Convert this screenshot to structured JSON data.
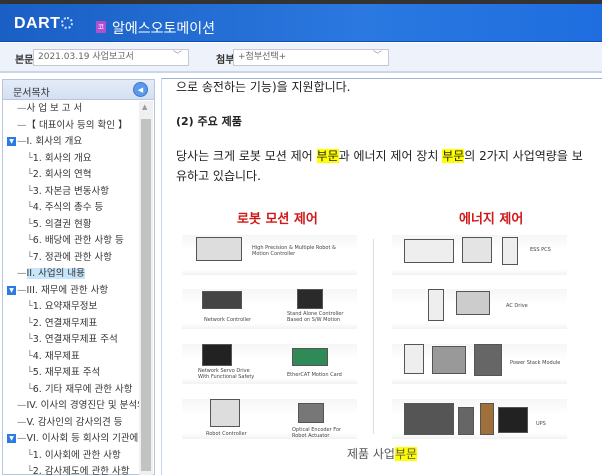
{
  "header": {
    "logo": "DART",
    "corp_badge": "코",
    "company": "알에스오토메이션"
  },
  "toolbar": {
    "main_label": "본문",
    "main_value": "2021.03.19  사업보고서",
    "attach_label": "첨부",
    "attach_value": "+첨부선택+"
  },
  "sidebar": {
    "title": "문서목차",
    "items": [
      {
        "label": "사 업 보 고 서",
        "level": 0
      },
      {
        "label": "【 대표이사 등의 확인 】",
        "level": 0
      },
      {
        "label": "I. 회사의 개요",
        "level": 0,
        "expanded": true
      },
      {
        "label": "1. 회사의 개요",
        "level": 1
      },
      {
        "label": "2. 회사의 연혁",
        "level": 1
      },
      {
        "label": "3. 자본금 변동사항",
        "level": 1
      },
      {
        "label": "4. 주식의 총수 등",
        "level": 1
      },
      {
        "label": "5. 의결권 현황",
        "level": 1
      },
      {
        "label": "6. 배당에 관한 사항 등",
        "level": 1
      },
      {
        "label": "7. 정관에 관한 사항",
        "level": 1
      },
      {
        "label": "II. 사업의 내용",
        "level": 0,
        "selected": true
      },
      {
        "label": "III. 재무에 관한 사항",
        "level": 0,
        "expanded": true
      },
      {
        "label": "1. 요약재무정보",
        "level": 1
      },
      {
        "label": "2. 연결재무제표",
        "level": 1
      },
      {
        "label": "3. 연결재무제표 주석",
        "level": 1
      },
      {
        "label": "4. 재무제표",
        "level": 1
      },
      {
        "label": "5. 재무제표 주석",
        "level": 1
      },
      {
        "label": "6. 기타 재무에 관한 사항",
        "level": 1
      },
      {
        "label": "IV. 이사의 경영진단 및 분석의견",
        "level": 0
      },
      {
        "label": "V. 감사인의 감사의견 등",
        "level": 0
      },
      {
        "label": "VI. 이사회 등 회사의 기관에 관한 사항",
        "level": 0,
        "expanded": true
      },
      {
        "label": "1. 이사회에 관한 사항",
        "level": 1
      },
      {
        "label": "2. 감사제도에 관한 사항",
        "level": 1
      }
    ]
  },
  "content": {
    "line_top": "으로 송전하는 기능)을 지원합니다.",
    "section_title": "(2) 주요 제품",
    "para1_a": "당사는 크게 로봇 모션 제어 ",
    "para1_hl1": "부문",
    "para1_b": "과 에너지 제어 장치 ",
    "para1_hl2": "부문",
    "para1_c": "의 2가지 사업역량을 보",
    "para2": "유하고 있습니다.",
    "figure": {
      "left_title": "로봇 모션 제어",
      "right_title": "에너지 제어",
      "left_labels": [
        "High Precision & Multiple Robot & Motion Controller",
        "Network Controller",
        "Stand Alone Controller Based on S/W Motion",
        "Network Servo Drive With Functional Safety",
        "EtherCAT Motion Card",
        "Robot Controller",
        "Optical Encoder For Robot Actuator"
      ],
      "right_labels": [
        "ESS PCS",
        "AC Drive",
        "Power Stack Module",
        "UPS"
      ]
    },
    "caption_a": "제품 사업",
    "caption_hl": "부문"
  }
}
